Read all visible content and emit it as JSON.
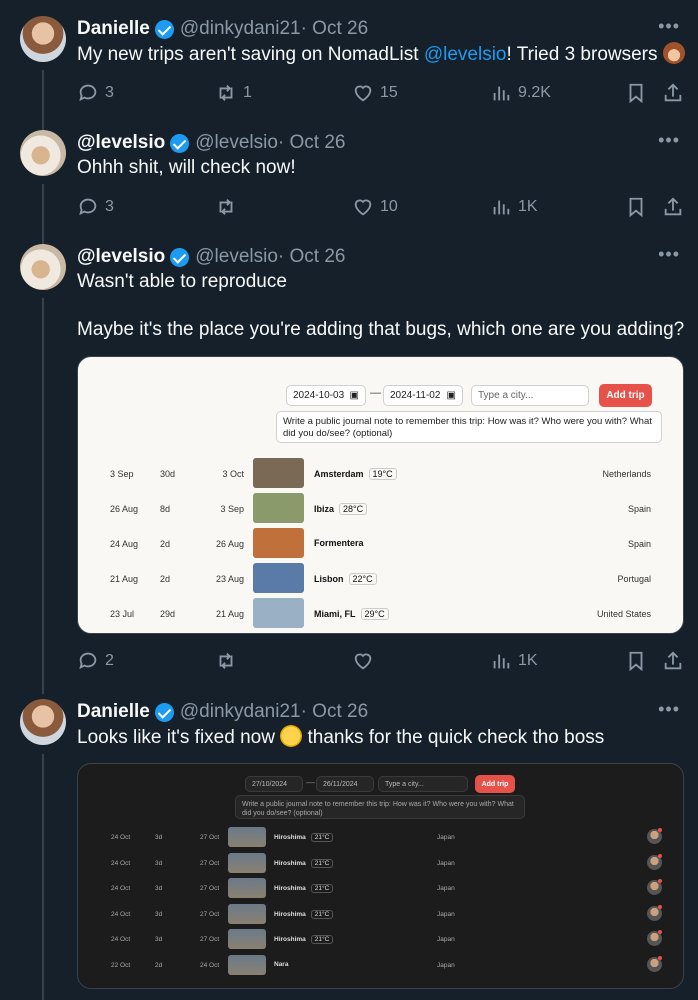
{
  "tweets": [
    {
      "name": "Danielle",
      "handle": "@dinkydani21",
      "date": "· Oct 26",
      "text": "My new trips aren't saving on NomadList ",
      "mention": "@levelsio",
      "text_after": "! Tried 3 browsers ",
      "emoji_icon": "see-no-evil-monkey-icon",
      "replies": "3",
      "reposts": "1",
      "likes": "15",
      "views": "9.2K"
    },
    {
      "name": "@levelsio",
      "handle": "@levelsio",
      "date": "· Oct 26",
      "text": "Ohhh shit, will check now!",
      "replies": "3",
      "reposts": "",
      "likes": "10",
      "views": "1K"
    },
    {
      "name": "@levelsio",
      "handle": "@levelsio",
      "date": "· Oct 26",
      "text": "Wasn't able to reproduce",
      "text2": "Maybe it's the place you're adding that bugs, which one are you adding?",
      "replies": "2",
      "reposts": "",
      "likes": "",
      "views": "1K"
    },
    {
      "name": "Danielle",
      "handle": "@dinkydani21",
      "date": "· Oct 26",
      "text_before": "Looks like it's fixed now ",
      "emoji_icon": "zany-face-icon",
      "text_after": " thanks for the quick check tho boss"
    }
  ],
  "shot1": {
    "date_from": "2024-10-03",
    "date_to": "2024-11-02",
    "dash": "—",
    "city_placeholder": "Type a city...",
    "add_button": "Add trip",
    "note": "Write a public journal note to remember this trip: How was it? Who were you with? What did you do/see? (optional)",
    "rows": [
      {
        "start": "3 Sep",
        "dur": "30d",
        "end": "3 Oct",
        "city": "Amsterdam",
        "temp": "19°C",
        "country": "Netherlands",
        "thumb": "#7a6a55"
      },
      {
        "start": "26 Aug",
        "dur": "8d",
        "end": "3 Sep",
        "city": "Ibiza",
        "temp": "28°C",
        "country": "Spain",
        "thumb": "#8a9a6a"
      },
      {
        "start": "24 Aug",
        "dur": "2d",
        "end": "26 Aug",
        "city": "Formentera",
        "temp": "",
        "country": "Spain",
        "thumb": "#c0703a"
      },
      {
        "start": "21 Aug",
        "dur": "2d",
        "end": "23 Aug",
        "city": "Lisbon",
        "temp": "22°C",
        "country": "Portugal",
        "thumb": "#5a7aa8"
      },
      {
        "start": "23 Jul",
        "dur": "29d",
        "end": "21 Aug",
        "city": "Miami, FL",
        "temp": "29°C",
        "country": "United States",
        "thumb": "#9ab0c4"
      }
    ]
  },
  "shot2": {
    "date_from": "27/10/2024",
    "date_to": "26/11/2024",
    "dash": "—",
    "city_placeholder": "Type a city...",
    "add_button": "Add trip",
    "note": "Write a public journal note to remember this trip: How was it? Who were you with? What did you do/see? (optional)",
    "rows": [
      {
        "start": "24 Oct",
        "dur": "3d",
        "end": "27 Oct",
        "city": "Hiroshima",
        "temp": "21°C",
        "country": "Japan"
      },
      {
        "start": "24 Oct",
        "dur": "3d",
        "end": "27 Oct",
        "city": "Hiroshima",
        "temp": "21°C",
        "country": "Japan"
      },
      {
        "start": "24 Oct",
        "dur": "3d",
        "end": "27 Oct",
        "city": "Hiroshima",
        "temp": "21°C",
        "country": "Japan"
      },
      {
        "start": "24 Oct",
        "dur": "3d",
        "end": "27 Oct",
        "city": "Hiroshima",
        "temp": "21°C",
        "country": "Japan"
      },
      {
        "start": "24 Oct",
        "dur": "3d",
        "end": "27 Oct",
        "city": "Hiroshima",
        "temp": "21°C",
        "country": "Japan"
      },
      {
        "start": "22 Oct",
        "dur": "2d",
        "end": "24 Oct",
        "city": "Nara",
        "temp": "",
        "country": "Japan"
      }
    ]
  },
  "colors": {
    "background": "#15202b",
    "accent": "#1d9bf0",
    "muted": "#8b98a5",
    "button": "#e6514a"
  }
}
